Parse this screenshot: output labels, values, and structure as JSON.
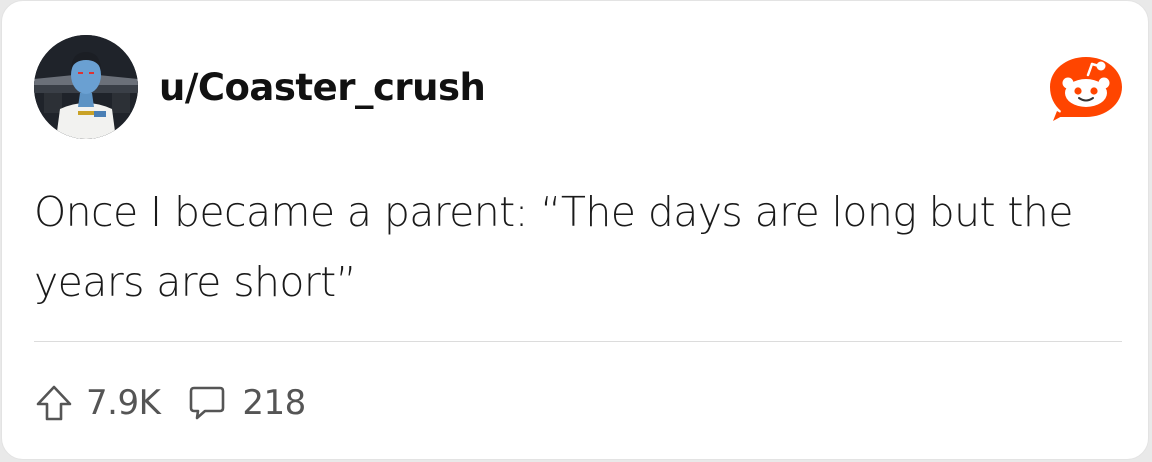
{
  "post": {
    "username": "u/Coaster_crush",
    "text": "Once I became a parent: “The days are long but the years are short”",
    "upvotes": "7.9K",
    "comments": "218"
  },
  "icons": {
    "avatar": "user-avatar",
    "brand": "reddit-logo-icon",
    "upvote": "upvote-arrow-icon",
    "comment": "comment-bubble-icon"
  },
  "colors": {
    "brand": "#ff4500",
    "text": "#1a1a1a",
    "muted": "#555555",
    "divider": "#dcdcdc"
  }
}
